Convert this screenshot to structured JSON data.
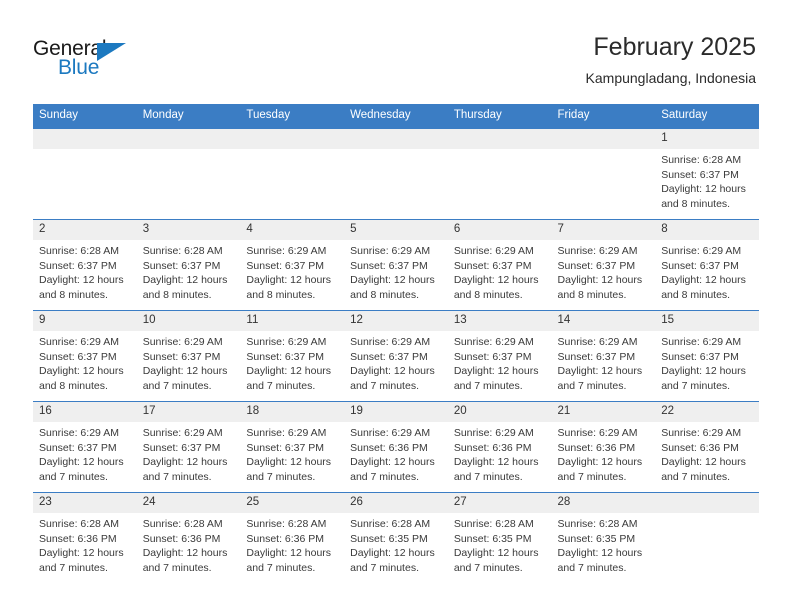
{
  "logo": {
    "word_top": "General",
    "word_bottom": "Blue",
    "accent_color": "#1c79c0"
  },
  "header": {
    "title": "February 2025",
    "subtitle": "Kampungladang, Indonesia"
  },
  "theme": {
    "header_row_bg": "#3b7dc4",
    "daynum_band_bg": "#efefef",
    "grid_line": "#3b7dc4"
  },
  "weekday_headers": [
    "Sunday",
    "Monday",
    "Tuesday",
    "Wednesday",
    "Thursday",
    "Friday",
    "Saturday"
  ],
  "weeks": [
    [
      {
        "day": "",
        "empty": true,
        "sunrise": "",
        "sunset": "",
        "daylight": ""
      },
      {
        "day": "",
        "empty": true,
        "sunrise": "",
        "sunset": "",
        "daylight": ""
      },
      {
        "day": "",
        "empty": true,
        "sunrise": "",
        "sunset": "",
        "daylight": ""
      },
      {
        "day": "",
        "empty": true,
        "sunrise": "",
        "sunset": "",
        "daylight": ""
      },
      {
        "day": "",
        "empty": true,
        "sunrise": "",
        "sunset": "",
        "daylight": ""
      },
      {
        "day": "",
        "empty": true,
        "sunrise": "",
        "sunset": "",
        "daylight": ""
      },
      {
        "day": "1",
        "empty": false,
        "sunrise": "Sunrise: 6:28 AM",
        "sunset": "Sunset: 6:37 PM",
        "daylight": "Daylight: 12 hours and 8 minutes."
      }
    ],
    [
      {
        "day": "2",
        "empty": false,
        "sunrise": "Sunrise: 6:28 AM",
        "sunset": "Sunset: 6:37 PM",
        "daylight": "Daylight: 12 hours and 8 minutes."
      },
      {
        "day": "3",
        "empty": false,
        "sunrise": "Sunrise: 6:28 AM",
        "sunset": "Sunset: 6:37 PM",
        "daylight": "Daylight: 12 hours and 8 minutes."
      },
      {
        "day": "4",
        "empty": false,
        "sunrise": "Sunrise: 6:29 AM",
        "sunset": "Sunset: 6:37 PM",
        "daylight": "Daylight: 12 hours and 8 minutes."
      },
      {
        "day": "5",
        "empty": false,
        "sunrise": "Sunrise: 6:29 AM",
        "sunset": "Sunset: 6:37 PM",
        "daylight": "Daylight: 12 hours and 8 minutes."
      },
      {
        "day": "6",
        "empty": false,
        "sunrise": "Sunrise: 6:29 AM",
        "sunset": "Sunset: 6:37 PM",
        "daylight": "Daylight: 12 hours and 8 minutes."
      },
      {
        "day": "7",
        "empty": false,
        "sunrise": "Sunrise: 6:29 AM",
        "sunset": "Sunset: 6:37 PM",
        "daylight": "Daylight: 12 hours and 8 minutes."
      },
      {
        "day": "8",
        "empty": false,
        "sunrise": "Sunrise: 6:29 AM",
        "sunset": "Sunset: 6:37 PM",
        "daylight": "Daylight: 12 hours and 8 minutes."
      }
    ],
    [
      {
        "day": "9",
        "empty": false,
        "sunrise": "Sunrise: 6:29 AM",
        "sunset": "Sunset: 6:37 PM",
        "daylight": "Daylight: 12 hours and 8 minutes."
      },
      {
        "day": "10",
        "empty": false,
        "sunrise": "Sunrise: 6:29 AM",
        "sunset": "Sunset: 6:37 PM",
        "daylight": "Daylight: 12 hours and 7 minutes."
      },
      {
        "day": "11",
        "empty": false,
        "sunrise": "Sunrise: 6:29 AM",
        "sunset": "Sunset: 6:37 PM",
        "daylight": "Daylight: 12 hours and 7 minutes."
      },
      {
        "day": "12",
        "empty": false,
        "sunrise": "Sunrise: 6:29 AM",
        "sunset": "Sunset: 6:37 PM",
        "daylight": "Daylight: 12 hours and 7 minutes."
      },
      {
        "day": "13",
        "empty": false,
        "sunrise": "Sunrise: 6:29 AM",
        "sunset": "Sunset: 6:37 PM",
        "daylight": "Daylight: 12 hours and 7 minutes."
      },
      {
        "day": "14",
        "empty": false,
        "sunrise": "Sunrise: 6:29 AM",
        "sunset": "Sunset: 6:37 PM",
        "daylight": "Daylight: 12 hours and 7 minutes."
      },
      {
        "day": "15",
        "empty": false,
        "sunrise": "Sunrise: 6:29 AM",
        "sunset": "Sunset: 6:37 PM",
        "daylight": "Daylight: 12 hours and 7 minutes."
      }
    ],
    [
      {
        "day": "16",
        "empty": false,
        "sunrise": "Sunrise: 6:29 AM",
        "sunset": "Sunset: 6:37 PM",
        "daylight": "Daylight: 12 hours and 7 minutes."
      },
      {
        "day": "17",
        "empty": false,
        "sunrise": "Sunrise: 6:29 AM",
        "sunset": "Sunset: 6:37 PM",
        "daylight": "Daylight: 12 hours and 7 minutes."
      },
      {
        "day": "18",
        "empty": false,
        "sunrise": "Sunrise: 6:29 AM",
        "sunset": "Sunset: 6:37 PM",
        "daylight": "Daylight: 12 hours and 7 minutes."
      },
      {
        "day": "19",
        "empty": false,
        "sunrise": "Sunrise: 6:29 AM",
        "sunset": "Sunset: 6:36 PM",
        "daylight": "Daylight: 12 hours and 7 minutes."
      },
      {
        "day": "20",
        "empty": false,
        "sunrise": "Sunrise: 6:29 AM",
        "sunset": "Sunset: 6:36 PM",
        "daylight": "Daylight: 12 hours and 7 minutes."
      },
      {
        "day": "21",
        "empty": false,
        "sunrise": "Sunrise: 6:29 AM",
        "sunset": "Sunset: 6:36 PM",
        "daylight": "Daylight: 12 hours and 7 minutes."
      },
      {
        "day": "22",
        "empty": false,
        "sunrise": "Sunrise: 6:29 AM",
        "sunset": "Sunset: 6:36 PM",
        "daylight": "Daylight: 12 hours and 7 minutes."
      }
    ],
    [
      {
        "day": "23",
        "empty": false,
        "sunrise": "Sunrise: 6:28 AM",
        "sunset": "Sunset: 6:36 PM",
        "daylight": "Daylight: 12 hours and 7 minutes."
      },
      {
        "day": "24",
        "empty": false,
        "sunrise": "Sunrise: 6:28 AM",
        "sunset": "Sunset: 6:36 PM",
        "daylight": "Daylight: 12 hours and 7 minutes."
      },
      {
        "day": "25",
        "empty": false,
        "sunrise": "Sunrise: 6:28 AM",
        "sunset": "Sunset: 6:36 PM",
        "daylight": "Daylight: 12 hours and 7 minutes."
      },
      {
        "day": "26",
        "empty": false,
        "sunrise": "Sunrise: 6:28 AM",
        "sunset": "Sunset: 6:35 PM",
        "daylight": "Daylight: 12 hours and 7 minutes."
      },
      {
        "day": "27",
        "empty": false,
        "sunrise": "Sunrise: 6:28 AM",
        "sunset": "Sunset: 6:35 PM",
        "daylight": "Daylight: 12 hours and 7 minutes."
      },
      {
        "day": "28",
        "empty": false,
        "sunrise": "Sunrise: 6:28 AM",
        "sunset": "Sunset: 6:35 PM",
        "daylight": "Daylight: 12 hours and 7 minutes."
      },
      {
        "day": "",
        "empty": true,
        "sunrise": "",
        "sunset": "",
        "daylight": ""
      }
    ]
  ]
}
